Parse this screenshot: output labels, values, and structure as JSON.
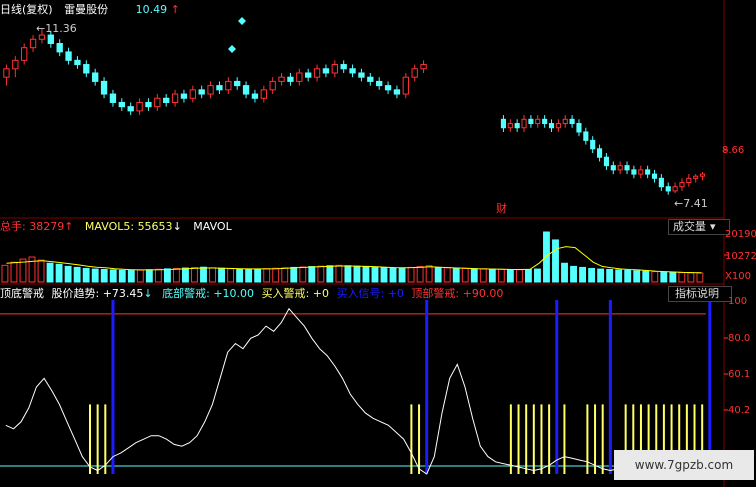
{
  "header": {
    "period": "日线(复权)",
    "stock": "雷曼股份",
    "price": "10.49",
    "price_arrow": "↑"
  },
  "price_panel": {
    "high_label": "11.36",
    "low_label": "7.41",
    "axis_label": "8.66",
    "marker": "财"
  },
  "volume_panel": {
    "total_label": "总手",
    "total_value": "38279",
    "total_arrow": "↑",
    "ma5_label": "MAVOL5",
    "ma5_value": "55653",
    "ma5_arrow": "↓",
    "ma10_label": "MAVOL",
    "button": "成交量",
    "axis_top": "20190",
    "axis_mid": "10272",
    "axis_unit": "X100"
  },
  "indicator_panel": {
    "name": "顶底警戒",
    "trend_label": "股价趋势",
    "trend_value": "+73.45",
    "trend_arrow": "↓",
    "bottom_label": "底部警戒",
    "bottom_value": "+10.00",
    "buy_label": "买入警戒",
    "buy_value": "+0",
    "signal_label": "买入信号",
    "signal_value": "+0",
    "top_label": "顶部警戒",
    "top_value": "+90.00",
    "button": "指标说明",
    "axis": [
      "100",
      "80.0",
      "60.1",
      "40.2"
    ]
  },
  "watermark": "www.7gpzb.com",
  "colors": {
    "up": "#ff3232",
    "down": "#54ffff",
    "ma": "#ffffff",
    "ma2": "#ffff00",
    "blue_bar": "#1c1cff",
    "yellow_bar": "#ffff66",
    "grid": "#800000"
  },
  "chart_data": [
    {
      "type": "candlestick",
      "title": "",
      "ylim": [
        7.0,
        11.7
      ],
      "segments": [
        {
          "ohlc": [
            [
              10.2,
              10.5,
              10.0,
              10.4
            ],
            [
              10.4,
              10.7,
              10.2,
              10.6
            ],
            [
              10.6,
              11.0,
              10.5,
              10.9
            ],
            [
              10.9,
              11.2,
              10.8,
              11.1
            ],
            [
              11.1,
              11.36,
              11.0,
              11.2
            ],
            [
              11.2,
              11.3,
              10.9,
              11.0
            ],
            [
              11.0,
              11.1,
              10.7,
              10.8
            ],
            [
              10.8,
              10.9,
              10.5,
              10.6
            ],
            [
              10.6,
              10.7,
              10.4,
              10.5
            ],
            [
              10.5,
              10.6,
              10.2,
              10.3
            ],
            [
              10.3,
              10.4,
              10.0,
              10.1
            ],
            [
              10.1,
              10.2,
              9.7,
              9.8
            ],
            [
              9.8,
              9.9,
              9.5,
              9.6
            ],
            [
              9.6,
              9.7,
              9.4,
              9.5
            ],
            [
              9.5,
              9.6,
              9.3,
              9.4
            ],
            [
              9.4,
              9.7,
              9.3,
              9.6
            ],
            [
              9.6,
              9.7,
              9.4,
              9.5
            ],
            [
              9.5,
              9.8,
              9.4,
              9.7
            ],
            [
              9.7,
              9.8,
              9.5,
              9.6
            ],
            [
              9.6,
              9.9,
              9.5,
              9.8
            ],
            [
              9.8,
              9.9,
              9.6,
              9.7
            ],
            [
              9.7,
              10.0,
              9.6,
              9.9
            ],
            [
              9.9,
              10.0,
              9.7,
              9.8
            ],
            [
              9.8,
              10.1,
              9.7,
              10.0
            ],
            [
              10.0,
              10.1,
              9.8,
              9.9
            ],
            [
              9.9,
              10.2,
              9.8,
              10.1
            ],
            [
              10.1,
              10.2,
              9.9,
              10.0
            ],
            [
              10.0,
              10.1,
              9.7,
              9.8
            ],
            [
              9.8,
              9.9,
              9.6,
              9.7
            ],
            [
              9.7,
              10.0,
              9.6,
              9.9
            ],
            [
              9.9,
              10.2,
              9.8,
              10.1
            ],
            [
              10.1,
              10.3,
              10.0,
              10.2
            ],
            [
              10.2,
              10.3,
              10.0,
              10.1
            ],
            [
              10.1,
              10.4,
              10.0,
              10.3
            ],
            [
              10.3,
              10.4,
              10.1,
              10.2
            ],
            [
              10.2,
              10.5,
              10.1,
              10.4
            ],
            [
              10.4,
              10.5,
              10.2,
              10.3
            ],
            [
              10.3,
              10.6,
              10.2,
              10.5
            ],
            [
              10.5,
              10.6,
              10.3,
              10.4
            ],
            [
              10.4,
              10.5,
              10.2,
              10.3
            ],
            [
              10.3,
              10.4,
              10.1,
              10.2
            ],
            [
              10.2,
              10.3,
              10.0,
              10.1
            ],
            [
              10.1,
              10.2,
              9.9,
              10.0
            ],
            [
              10.0,
              10.1,
              9.8,
              9.9
            ],
            [
              9.9,
              10.0,
              9.7,
              9.8
            ],
            [
              9.8,
              10.3,
              9.7,
              10.2
            ],
            [
              10.2,
              10.5,
              10.1,
              10.4
            ],
            [
              10.4,
              10.6,
              10.3,
              10.5
            ]
          ]
        },
        {
          "ohlc": [
            [
              9.2,
              9.3,
              8.9,
              9.0
            ],
            [
              9.0,
              9.2,
              8.9,
              9.1
            ],
            [
              9.1,
              9.2,
              8.9,
              9.0
            ],
            [
              9.0,
              9.3,
              8.9,
              9.2
            ],
            [
              9.2,
              9.3,
              9.0,
              9.1
            ],
            [
              9.1,
              9.3,
              9.0,
              9.2
            ],
            [
              9.2,
              9.3,
              9.0,
              9.1
            ],
            [
              9.1,
              9.2,
              8.9,
              9.0
            ],
            [
              9.0,
              9.2,
              8.9,
              9.1
            ],
            [
              9.1,
              9.3,
              9.0,
              9.2
            ],
            [
              9.2,
              9.3,
              9.0,
              9.1
            ],
            [
              9.1,
              9.2,
              8.8,
              8.9
            ],
            [
              8.9,
              9.0,
              8.6,
              8.7
            ],
            [
              8.7,
              8.8,
              8.4,
              8.5
            ],
            [
              8.5,
              8.6,
              8.2,
              8.3
            ],
            [
              8.3,
              8.4,
              8.0,
              8.1
            ],
            [
              8.1,
              8.2,
              7.9,
              8.0
            ],
            [
              8.0,
              8.2,
              7.9,
              8.1
            ],
            [
              8.1,
              8.2,
              7.9,
              8.0
            ],
            [
              8.0,
              8.1,
              7.8,
              7.9
            ],
            [
              7.9,
              8.1,
              7.8,
              8.0
            ],
            [
              8.0,
              8.1,
              7.8,
              7.9
            ],
            [
              7.9,
              8.0,
              7.7,
              7.8
            ],
            [
              7.8,
              7.9,
              7.5,
              7.6
            ],
            [
              7.6,
              7.7,
              7.41,
              7.5
            ],
            [
              7.5,
              7.7,
              7.45,
              7.6
            ],
            [
              7.6,
              7.8,
              7.5,
              7.7
            ],
            [
              7.7,
              7.9,
              7.6,
              7.8
            ],
            [
              7.8,
              7.9,
              7.7,
              7.85
            ],
            [
              7.85,
              7.95,
              7.75,
              7.9
            ]
          ]
        }
      ]
    },
    {
      "type": "bar",
      "title": "",
      "ylabel": "",
      "ylim": [
        0,
        24000
      ],
      "values": [
        8000,
        9500,
        11000,
        12000,
        10500,
        9000,
        8500,
        7500,
        7000,
        6500,
        6200,
        6000,
        5800,
        5600,
        5500,
        5700,
        5900,
        6100,
        6300,
        6500,
        6700,
        6900,
        7100,
        6800,
        6600,
        6400,
        6200,
        6000,
        6200,
        6400,
        6600,
        6800,
        7000,
        7200,
        7400,
        7600,
        7800,
        8000,
        7800,
        7600,
        7400,
        7200,
        7000,
        6800,
        6600,
        7000,
        7400,
        7800,
        7000,
        6800,
        6600,
        6500,
        6400,
        6300,
        6200,
        6100,
        6000,
        5900,
        6000,
        6200,
        24000,
        20190,
        9000,
        7500,
        7000,
        6500,
        6200,
        6000,
        5800,
        5600,
        5400,
        5200,
        5000,
        4800,
        4600,
        4500,
        4400,
        4300
      ],
      "up": [
        true,
        true,
        true,
        true,
        true,
        false,
        false,
        false,
        false,
        false,
        false,
        false,
        false,
        false,
        false,
        true,
        false,
        true,
        false,
        true,
        false,
        true,
        false,
        true,
        false,
        true,
        false,
        false,
        false,
        true,
        true,
        true,
        false,
        true,
        false,
        true,
        false,
        true,
        false,
        false,
        false,
        false,
        false,
        false,
        false,
        true,
        true,
        true,
        false,
        true,
        false,
        true,
        false,
        true,
        false,
        true,
        false,
        true,
        false,
        false,
        false,
        false,
        false,
        false,
        false,
        false,
        false,
        false,
        false,
        false,
        false,
        false,
        true,
        false,
        false,
        true,
        true,
        true
      ],
      "ma5": [
        9000,
        9300,
        9600,
        10000,
        10200,
        9800,
        9300,
        8800,
        8200,
        7600,
        7100,
        6800,
        6400,
        6100,
        5900,
        5800,
        5800,
        5900,
        6000,
        6200,
        6400,
        6600,
        6700,
        6700,
        6600,
        6500,
        6400,
        6300,
        6300,
        6300,
        6400,
        6600,
        6800,
        7000,
        7200,
        7400,
        7600,
        7700,
        7700,
        7600,
        7500,
        7300,
        7100,
        6900,
        6800,
        6900,
        7100,
        7300,
        7100,
        6900,
        6700,
        6600,
        6400,
        6300,
        6200,
        6100,
        6000,
        6000,
        6100,
        9000,
        13000,
        16000,
        17000,
        16500,
        13000,
        9500,
        7500,
        6800,
        6300,
        6000,
        5800,
        5500,
        5200,
        5000,
        4800,
        4600,
        4500,
        4400
      ]
    },
    {
      "type": "line",
      "title": "",
      "ylim": [
        0,
        100
      ],
      "series": [
        {
          "values": [
            28,
            26,
            30,
            38,
            50,
            55,
            48,
            40,
            30,
            20,
            10,
            4,
            2,
            5,
            10,
            12,
            15,
            18,
            20,
            22,
            22,
            20,
            17,
            16,
            18,
            22,
            30,
            40,
            55,
            70,
            75,
            72,
            78,
            80,
            85,
            82,
            87,
            95,
            90,
            85,
            78,
            72,
            68,
            62,
            55,
            46,
            40,
            35,
            32,
            30,
            28,
            24,
            20,
            12,
            3,
            0,
            10,
            35,
            55,
            63,
            50,
            32,
            16,
            10,
            7,
            6,
            5,
            4,
            3,
            2,
            3,
            5,
            8,
            10,
            9,
            8,
            7,
            5,
            3,
            2,
            3,
            4,
            5,
            6,
            5,
            4,
            3,
            2,
            2,
            3,
            4,
            5
          ]
        }
      ],
      "hlines": [
        0,
        92
      ],
      "blue_signals": [
        14,
        55,
        72,
        79,
        92
      ],
      "yellow_groups": [
        [
          11,
          12,
          13
        ],
        [
          53,
          54,
          55
        ],
        [
          66,
          67,
          68,
          69,
          70,
          71,
          72,
          73
        ],
        [
          76,
          77,
          78
        ],
        [
          81,
          82,
          83,
          84,
          85,
          86,
          87,
          88,
          89,
          90,
          91
        ]
      ],
      "yellow_height": 40
    }
  ]
}
